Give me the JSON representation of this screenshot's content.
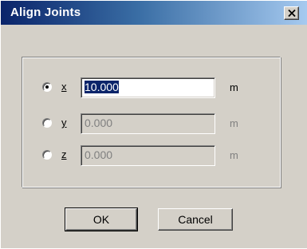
{
  "window": {
    "title": "Align Joints"
  },
  "rows": [
    {
      "axis": "x",
      "value": "10.000",
      "unit": "m",
      "selected": true
    },
    {
      "axis": "y",
      "value": "0.000",
      "unit": "m",
      "selected": false
    },
    {
      "axis": "z",
      "value": "0.000",
      "unit": "m",
      "selected": false
    }
  ],
  "buttons": {
    "ok_label": "OK",
    "cancel_label": "Cancel"
  },
  "colors": {
    "titlebar_start": "#0a246a",
    "titlebar_end": "#a6caf0",
    "dialog_face": "#d4d0c8",
    "selection": "#0a246a"
  },
  "icons": {
    "close": "close-icon"
  }
}
